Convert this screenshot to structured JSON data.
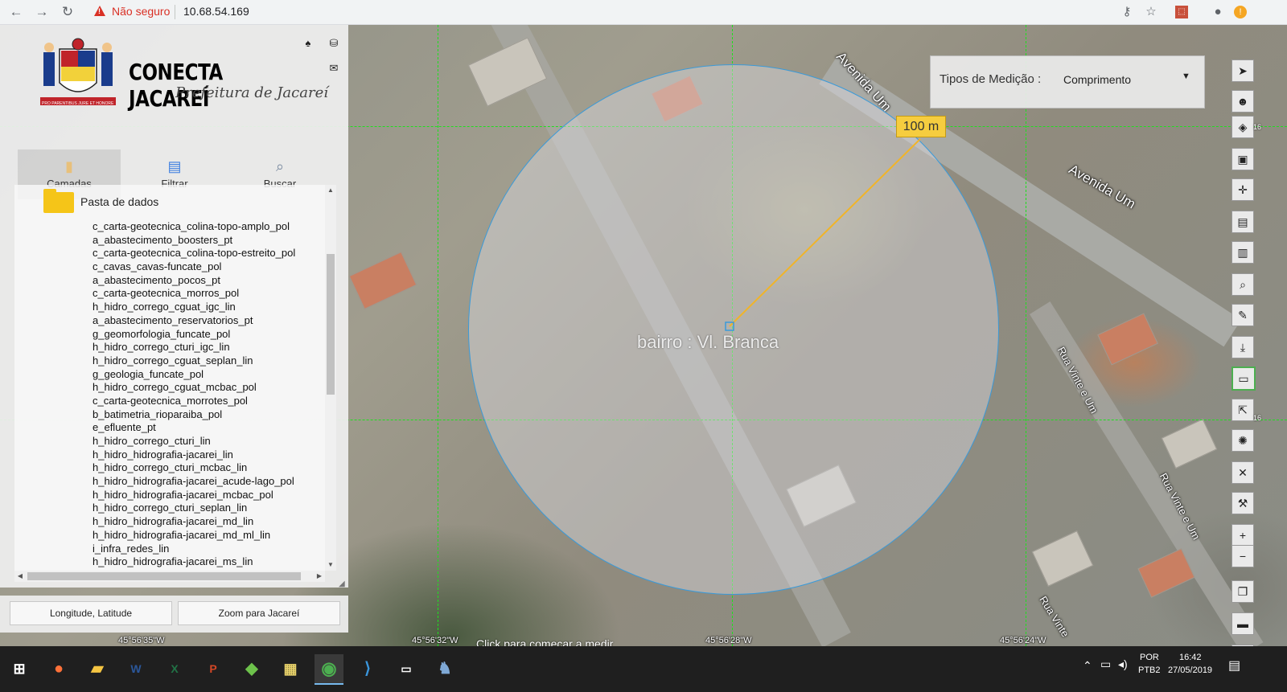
{
  "browser": {
    "security_label": "Não seguro",
    "url": "10.68.54.169"
  },
  "brand": {
    "title": "CONECTA JACAREÍ",
    "subtitle": "Prefeitura de Jacareí",
    "motto": "PRO PARENTIBUS JURE ET HONORE"
  },
  "tabs": [
    {
      "label": "Camadas",
      "icon": "layers-icon"
    },
    {
      "label": "Filtrar",
      "icon": "document-icon"
    },
    {
      "label": "Buscar",
      "icon": "magnifier-icon"
    }
  ],
  "tree": {
    "folder_label": "Pasta de dados",
    "layers": [
      "c_carta-geotecnica_colina-topo-amplo_pol",
      "a_abastecimento_boosters_pt",
      "c_carta-geotecnica_colina-topo-estreito_pol",
      "c_cavas_cavas-funcate_pol",
      "a_abastecimento_pocos_pt",
      "c_carta-geotecnica_morros_pol",
      "h_hidro_corrego_cguat_igc_lin",
      "a_abastecimento_reservatorios_pt",
      "g_geomorfologia_funcate_pol",
      "h_hidro_corrego_cturi_igc_lin",
      "h_hidro_corrego_cguat_seplan_lin",
      "g_geologia_funcate_pol",
      "h_hidro_corrego_cguat_mcbac_pol",
      "c_carta-geotecnica_morrotes_pol",
      "b_batimetria_rioparaiba_pol",
      "e_efluente_pt",
      "h_hidro_corrego_cturi_lin",
      "h_hidro_hidrografia-jacarei_lin",
      "h_hidro_corrego_cturi_mcbac_lin",
      "h_hidro_hidrografia-jacarei_acude-lago_pol",
      "h_hidro_hidrografia-jacarei_mcbac_pol",
      "h_hidro_corrego_cturi_seplan_lin",
      "h_hidro_hidrografia-jacarei_md_lin",
      "h_hidro_hidrografia-jacarei_md_ml_lin",
      "i_infra_redes_lin",
      "h_hidro_hidrografia-jacarei_ms_lin"
    ]
  },
  "panel_buttons": {
    "lonlat": "Longitude, Latitude",
    "zoom": "Zoom para Jacareí"
  },
  "map": {
    "tipos_label": "Tipos de Medição :",
    "tipos_value": "Comprimento",
    "radius_label": "100 m",
    "bairro_label": "bairro : Vl. Branca",
    "measure_hint": "Click para começar a medir",
    "roads": [
      "Avenida Um",
      "Avenida Um",
      "Rua Vinte e Um",
      "Rua Vinte e Um",
      "Rua Vinte"
    ],
    "coords": [
      "45°56'35\"W",
      "45°56'32\"W",
      "45°56'28\"W",
      "45°56'24\"W"
    ],
    "tool_badges": [
      "16",
      "16"
    ]
  },
  "taskbar": {
    "language": "POR",
    "keyboard": "PTB2",
    "time": "16:42",
    "date": "27/05/2019"
  },
  "colors": {
    "accent_badge": "#f6cd3f",
    "circle_stroke": "#3a9ad9",
    "grid": "#1ee01e",
    "warning": "#d93025"
  }
}
